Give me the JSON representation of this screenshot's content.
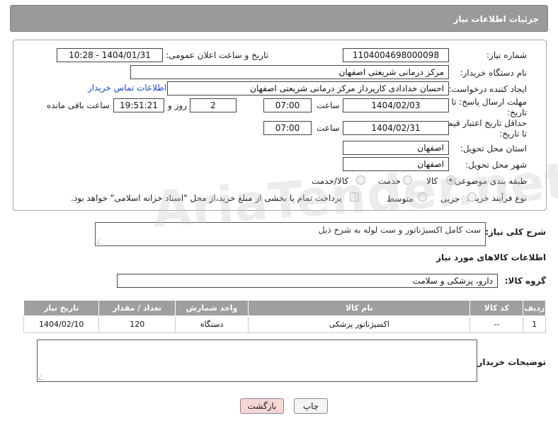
{
  "header": {
    "title": "جزئیات اطلاعات نیاز"
  },
  "form": {
    "need_number_label": "شماره نیاز:",
    "need_number": "1104004698000098",
    "announce_label": "تاریخ و ساعت اعلان عمومی:",
    "announce_value": "1404/01/31 - 10:28",
    "buyer_org_label": "نام دستگاه خریدار:",
    "buyer_org": "مرکز درمانی شریعتی اصفهان",
    "creator_label": "ایجاد کننده درخواست:",
    "creator": "احسان خدادادی کارپرداز مرکز درمانی شریعتی اصفهان",
    "contact_link": "اطلاعات تماس خریدار",
    "deadline_label": "مهلت ارسال پاسخ: تا تاریخ:",
    "deadline_date": "1404/02/03",
    "time_label": "ساعت",
    "deadline_time": "07:00",
    "days_value": "2",
    "days_label": "روز و",
    "remaining_value": "19:51:21",
    "remaining_label": "ساعت باقی مانده",
    "price_validity_label": "حداقل تاریخ اعتبار قیمت: تا تاریخ:",
    "price_validity_date": "1404/02/31",
    "price_validity_time": "07:00",
    "province_label": "استان محل تحویل:",
    "province": "اصفهان",
    "city_label": "شهر محل تحویل:",
    "city": "اصفهان",
    "category_label": "طبقه بندی موضوعی:",
    "category_options": [
      "کالا",
      "خدمت",
      "کالا/خدمت"
    ],
    "category_selected": "کالا",
    "process_label": "نوع فرآیند خرید :",
    "process_options": [
      "جزیی",
      "متوسط"
    ],
    "payment_note": "پرداخت تمام یا بخشی از مبلغ خرید،از محل \"اسناد خزانه اسلامی\" خواهد بود."
  },
  "description": {
    "label": "شرح کلی نیاز:",
    "value": "ست کامل اکسیژناتور و ست لوله به شرح ذیل"
  },
  "goods_info": {
    "title": "اطلاعات کالاهای مورد نیاز",
    "group_label": "گروه کالا:",
    "group_value": "دارو، پزشکی و سلامت",
    "columns": [
      "ردیف",
      "کد کالا",
      "نام کالا",
      "واحد شمارش",
      "تعداد / مقدار",
      "تاریخ نیاز"
    ],
    "rows": [
      {
        "row": "1",
        "code": "--",
        "name": "اکسیژناتور پزشکی",
        "unit": "دستگاه",
        "qty": "120",
        "date": "1404/02/10"
      }
    ]
  },
  "buyer_notes": {
    "label": "توضیحات خریدار:",
    "value": ""
  },
  "actions": {
    "print_label": "چاپ",
    "back_label": "بازگشت"
  },
  "watermark": {
    "text": "AriaTender.net"
  },
  "colors": {
    "header_bg": "#9a9a9a",
    "link": "#1a48c4",
    "back_button_bg": "#f7d6d6"
  }
}
